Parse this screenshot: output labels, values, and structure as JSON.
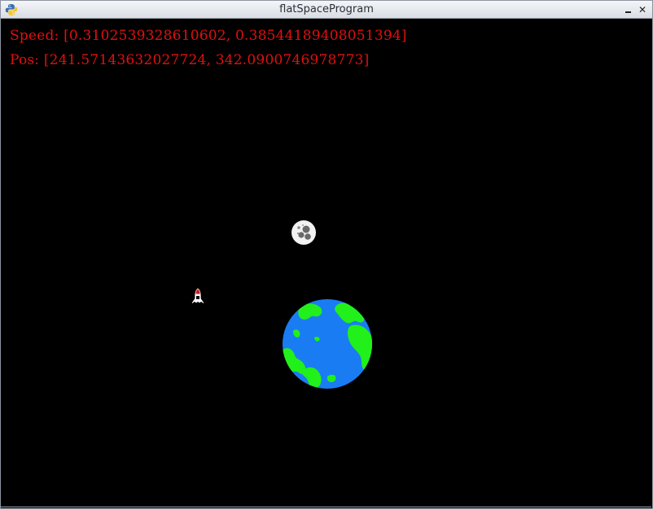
{
  "window": {
    "title": "flatSpaceProgram",
    "minimize_glyph": "_",
    "close_glyph": "✕",
    "app_icon": "python-icon"
  },
  "hud": {
    "speed_text": "Speed: [0.3102539328610602, 0.38544189408051394]",
    "pos_text": "Pos: [241.57143632027724, 342.0900746978773]",
    "color": "#e01010"
  },
  "scene": {
    "background": "#000000",
    "objects": [
      {
        "kind": "moon",
        "icon": "moon-icon"
      },
      {
        "kind": "rocket",
        "icon": "rocket-icon"
      },
      {
        "kind": "planet",
        "icon": "earth-icon",
        "ocean_color": "#1a7cf2",
        "land_color": "#22f01a"
      }
    ]
  }
}
